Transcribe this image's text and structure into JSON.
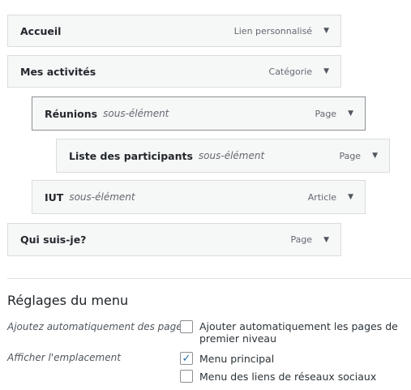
{
  "items": [
    {
      "title": "Accueil",
      "sub": "",
      "type": "Lien personnalisé"
    },
    {
      "title": "Mes activités",
      "sub": "",
      "type": "Catégorie"
    },
    {
      "title": "Réunions",
      "sub": "sous-élément",
      "type": "Page"
    },
    {
      "title": "Liste des participants",
      "sub": "sous-élément",
      "type": "Page"
    },
    {
      "title": "IUT",
      "sub": "sous-élément",
      "type": "Article"
    },
    {
      "title": "Qui suis-je?",
      "sub": "",
      "type": "Page"
    }
  ],
  "settings": {
    "heading": "Réglages du menu",
    "auto_label": "Ajoutez automatiquement des pages",
    "auto_option": "Ajouter automatiquement les pages de premier niveau",
    "location_label": "Afficher l'emplacement",
    "locations": [
      {
        "label": "Menu principal",
        "checked": true
      },
      {
        "label": "Menu des liens de réseaux sociaux",
        "checked": false
      }
    ]
  },
  "accent": "#2271b1"
}
